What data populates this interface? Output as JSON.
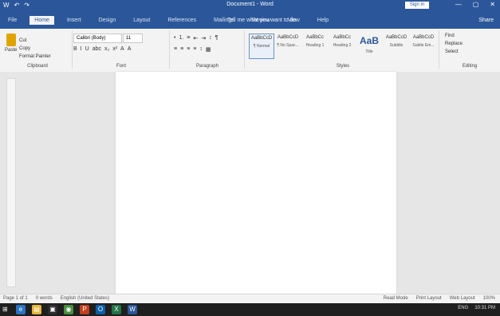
{
  "titlebar": {
    "title": "Document1 - Word",
    "signin": "Sign in",
    "qat": [
      "W",
      "↶",
      "↷"
    ],
    "winbtns": [
      "—",
      "▢",
      "✕"
    ]
  },
  "tabs": [
    "File",
    "Home",
    "Insert",
    "Design",
    "Layout",
    "References",
    "Mailings",
    "Review",
    "View",
    "Help"
  ],
  "tell_me": "Tell me what you want to do",
  "share": "Share",
  "ribbon": {
    "clipboard": {
      "paste": "Paste",
      "mini": [
        "Cut",
        "Copy",
        "Format Painter"
      ],
      "label": "Clipboard"
    },
    "font": {
      "name": "Calibri (Body)",
      "size": "11",
      "buttons": [
        "B",
        "I",
        "U",
        "abc",
        "x₂",
        "x²",
        "A",
        "A"
      ],
      "label": "Font"
    },
    "paragraph": {
      "row1": [
        "•",
        "1.",
        "≡",
        "⇤",
        "⇥",
        "↕",
        "¶"
      ],
      "row2": [
        "≡",
        "≡",
        "≡",
        "≡",
        "↕",
        "▦"
      ],
      "label": "Paragraph"
    },
    "styles": {
      "items": [
        {
          "sample": "AaBbCcD",
          "name": "¶ Normal"
        },
        {
          "sample": "AaBbCcD",
          "name": "¶ No Spac..."
        },
        {
          "sample": "AaBbCc",
          "name": "Heading 1"
        },
        {
          "sample": "AaBbCc",
          "name": "Heading 2"
        },
        {
          "sample": "AaB",
          "name": "Title"
        },
        {
          "sample": "AaBbCcD",
          "name": "Subtitle"
        },
        {
          "sample": "AaBbCcD",
          "name": "Subtle Em..."
        }
      ],
      "label": "Styles"
    },
    "editing": {
      "items": [
        "Find",
        "Replace",
        "Select"
      ],
      "label": "Editing"
    }
  },
  "status": {
    "left": [
      "Page 1 of 1",
      "0 words",
      "English (United States)"
    ],
    "right": [
      "Read Mode",
      "Print Layout",
      "Web Layout",
      "100%"
    ]
  },
  "taskbar": {
    "apps": [
      {
        "name": "edge",
        "color": "#2b73c5",
        "glyph": "e"
      },
      {
        "name": "file-explorer",
        "color": "#e7b53a",
        "glyph": "▤"
      },
      {
        "name": "store",
        "color": "#2d2d2d",
        "glyph": "▣"
      },
      {
        "name": "chrome",
        "color": "#4a8f3f",
        "glyph": "◉"
      },
      {
        "name": "powerpoint",
        "color": "#c43e1c",
        "glyph": "P"
      },
      {
        "name": "outlook",
        "color": "#0f5ea8",
        "glyph": "O"
      },
      {
        "name": "excel",
        "color": "#217346",
        "glyph": "X"
      },
      {
        "name": "word",
        "color": "#2b579a",
        "glyph": "W"
      }
    ],
    "tray": [
      "ENG",
      "10:31 PM"
    ]
  }
}
